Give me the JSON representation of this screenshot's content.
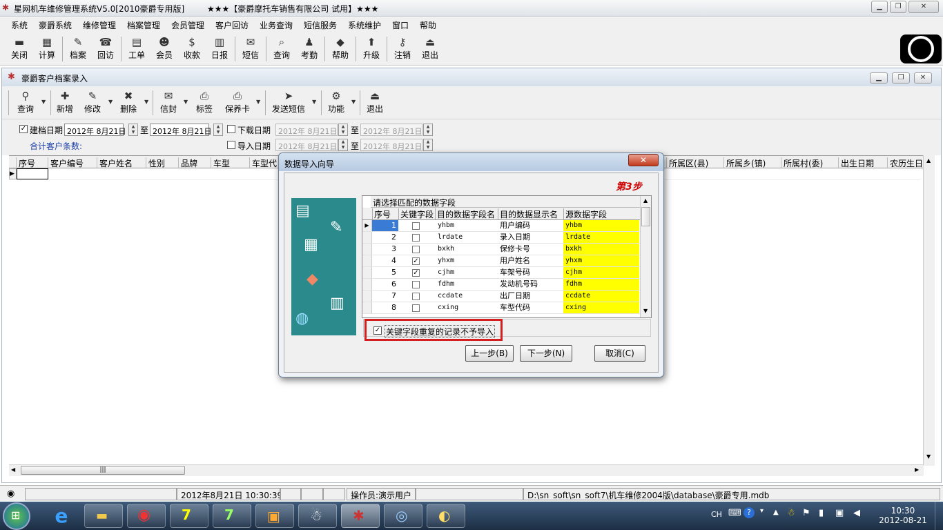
{
  "app": {
    "title": "星网机车维修管理系统V5.0[2010豪爵专用版]",
    "subtitle": "★★★【豪爵摩托车销售有限公司 试用】★★★"
  },
  "menu": [
    "系统",
    "豪爵系统",
    "维修管理",
    "档案管理",
    "会员管理",
    "客户回访",
    "业务查询",
    "短信服务",
    "系统维护",
    "窗口",
    "帮助"
  ],
  "toolbar": [
    {
      "label": "关闭",
      "icon": "▬"
    },
    {
      "label": "计算",
      "icon": "▦"
    },
    {
      "label": "档案",
      "icon": "✎"
    },
    {
      "label": "回访",
      "icon": "☎"
    },
    {
      "label": "工单",
      "icon": "▤"
    },
    {
      "label": "会员",
      "icon": "☻"
    },
    {
      "label": "收款",
      "icon": "$"
    },
    {
      "label": "日报",
      "icon": "▥"
    },
    {
      "label": "短信",
      "icon": "✉"
    },
    {
      "label": "查询",
      "icon": "⌕"
    },
    {
      "label": "考勤",
      "icon": "♟"
    },
    {
      "label": "帮助",
      "icon": "◆"
    },
    {
      "label": "升级",
      "icon": "⬆"
    },
    {
      "label": "注销",
      "icon": "⚷"
    },
    {
      "label": "退出",
      "icon": "⏏"
    }
  ],
  "child": {
    "title": "豪爵客户档案录入",
    "toolbar": [
      {
        "label": "查询",
        "icon": "⚲"
      },
      {
        "label": "新增",
        "icon": "✚"
      },
      {
        "label": "修改",
        "icon": "✎"
      },
      {
        "label": "删除",
        "icon": "✖"
      },
      {
        "label": "信封",
        "icon": "✉"
      },
      {
        "label": "标签",
        "icon": "⎙"
      },
      {
        "label": "保养卡",
        "icon": "⎙"
      },
      {
        "label": "发送短信",
        "icon": "➤"
      },
      {
        "label": "功能",
        "icon": "⚙"
      },
      {
        "label": "退出",
        "icon": "⏏"
      }
    ]
  },
  "filter": {
    "create_date_label": "建档日期",
    "create_from": "2012年 8月21日",
    "to": "至",
    "create_to": "2012年 8月21日",
    "download_label": "下载日期",
    "dl_from": "2012年 8月21日",
    "dl_to": "2012年 8月21日",
    "import_label": "导入日期",
    "im_from": "2012年 8月21日",
    "im_to": "2012年 8月21日",
    "total_label": "合计客户条数:"
  },
  "grid": {
    "columns": [
      "序号",
      "客户编号",
      "客户姓名",
      "性别",
      "品牌",
      "车型",
      "车型代",
      "所属区(县)",
      "所属乡(镇)",
      "所属村(委)",
      "出生日期",
      "农历生日"
    ]
  },
  "dialog": {
    "title": "数据导入向导",
    "step": "第3步",
    "caption": "请选择匹配的数据字段",
    "headers": [
      "序号",
      "关键字段",
      "目的数据字段名",
      "目的数据显示名",
      "源数据字段"
    ],
    "rows": [
      {
        "no": "1",
        "key": false,
        "field": "yhbm",
        "display": "用户编码",
        "source": "yhbm"
      },
      {
        "no": "2",
        "key": false,
        "field": "lrdate",
        "display": "录入日期",
        "source": "lrdate"
      },
      {
        "no": "3",
        "key": false,
        "field": "bxkh",
        "display": "保修卡号",
        "source": "bxkh"
      },
      {
        "no": "4",
        "key": true,
        "field": "yhxm",
        "display": "用户姓名",
        "source": "yhxm"
      },
      {
        "no": "5",
        "key": true,
        "field": "cjhm",
        "display": "车架号码",
        "source": "cjhm"
      },
      {
        "no": "6",
        "key": false,
        "field": "fdhm",
        "display": "发动机号码",
        "source": "fdhm"
      },
      {
        "no": "7",
        "key": false,
        "field": "ccdate",
        "display": "出厂日期",
        "source": "ccdate"
      },
      {
        "no": "8",
        "key": false,
        "field": "cxing",
        "display": "车型代码",
        "source": "cxing"
      }
    ],
    "skip_label": "关键字段重复的记录不予导入",
    "prev": "上一步(B)",
    "next": "下一步(N)",
    "cancel": "取消(C)"
  },
  "status": {
    "datetime": "2012年8月21日 10:30:39",
    "operator": "操作员:演示用户",
    "path": "D:\\sn_soft\\sn_soft7\\机车维修2004版\\database\\豪爵专用.mdb"
  },
  "tray": {
    "lang": "CH",
    "time": "10:30",
    "date": "2012-08-21"
  },
  "colors": {
    "highlight": "#ffff00",
    "accent": "#d21f1f"
  }
}
